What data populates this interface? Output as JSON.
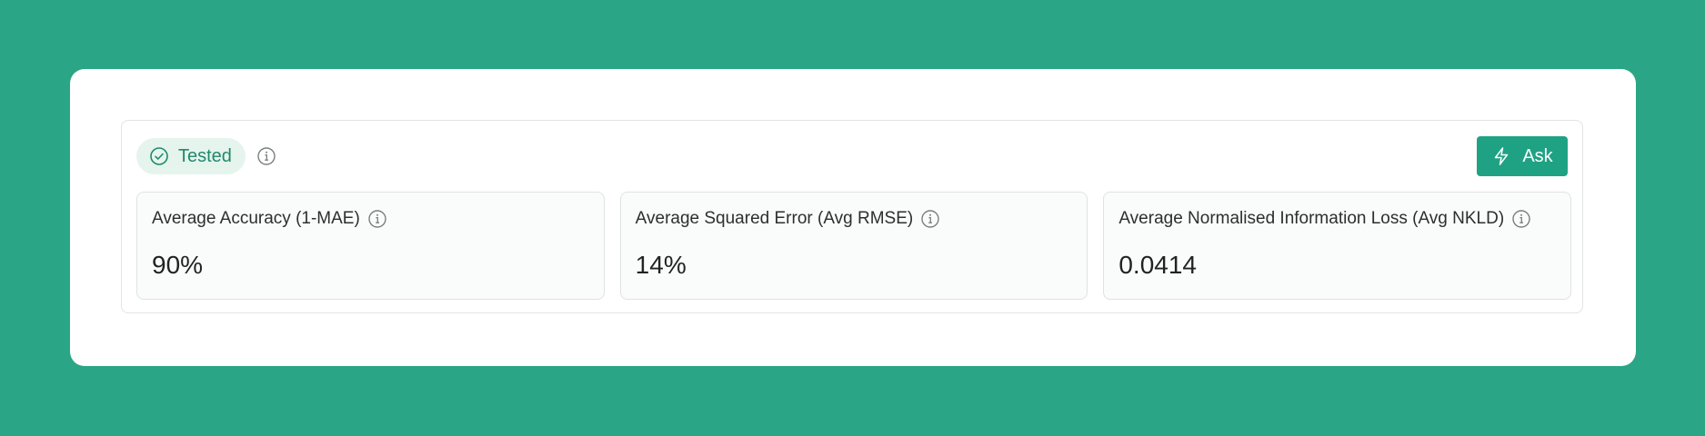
{
  "status": {
    "label": "Tested",
    "color": "#1f8a6a",
    "icon": "check-circle-icon",
    "info_icon": "info-icon"
  },
  "actions": {
    "ask_label": "Ask",
    "ask_icon": "lightning-bolt-icon"
  },
  "metrics": [
    {
      "title": "Average Accuracy (1-MAE)",
      "value": "90%",
      "info_icon": "info-icon"
    },
    {
      "title": "Average Squared Error (Avg RMSE)",
      "value": "14%",
      "info_icon": "info-icon"
    },
    {
      "title": "Average Normalised Information Loss (Avg NKLD)",
      "value": "0.0414",
      "info_icon": "info-icon"
    }
  ],
  "colors": {
    "background": "#2aa586",
    "accent": "#1fa283",
    "badge_bg": "#e6f4ee"
  }
}
